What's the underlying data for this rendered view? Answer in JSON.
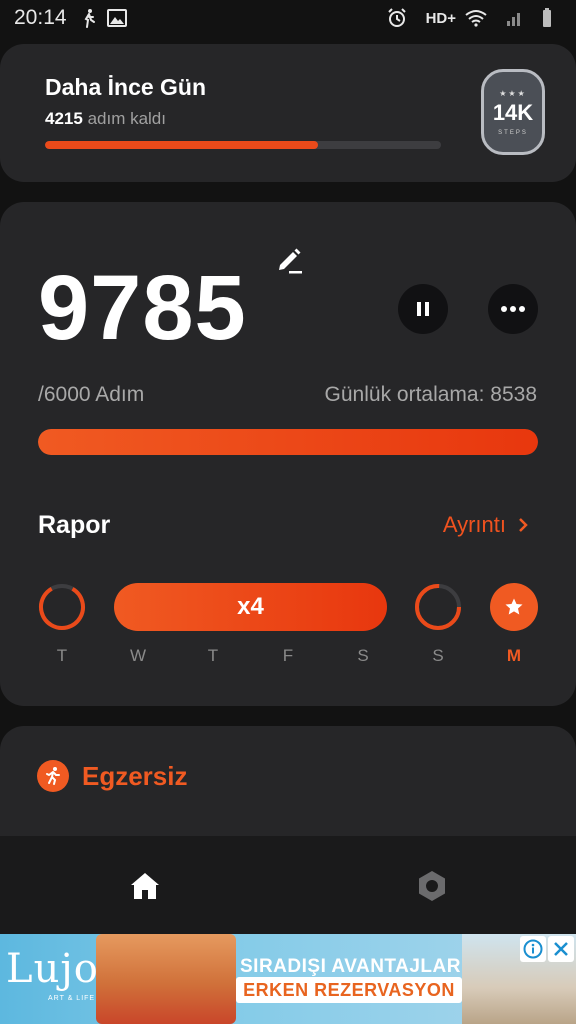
{
  "status_bar": {
    "time": "20:14",
    "network_label": "HD+",
    "icons": [
      "walking-icon",
      "image-icon",
      "alarm-icon",
      "wifi-icon",
      "signal-icon",
      "battery-icon"
    ]
  },
  "goal_card": {
    "title": "Daha İnce Gün",
    "remaining_value": "4215",
    "remaining_label": "adım kaldı",
    "progress_fraction": 0.69,
    "badge_value": "14K",
    "badge_label": "STEPS"
  },
  "main_card": {
    "steps": "9785",
    "goal_text": "/6000 Adım",
    "average_text": "Günlük ortalama: 8538",
    "progress_fraction": 1.0,
    "report_title": "Rapor",
    "detail_label": "Ayrıntı",
    "streak_label": "x4",
    "days": [
      "T",
      "W",
      "T",
      "F",
      "S",
      "S",
      "M"
    ],
    "active_day_index": 6
  },
  "exercise_card": {
    "title": "Egzersiz"
  },
  "bottom_nav": {
    "items": [
      "home-icon",
      "settings-icon"
    ]
  },
  "ad": {
    "logo": "Lujo",
    "logo_sub": "ART & LIFE",
    "line1": "SIRADIŞI AVANTAJLAR",
    "line2": "ERKEN REZERVASYON"
  },
  "colors": {
    "accent": "#f05a22",
    "card": "#262628",
    "background": "#121212"
  }
}
